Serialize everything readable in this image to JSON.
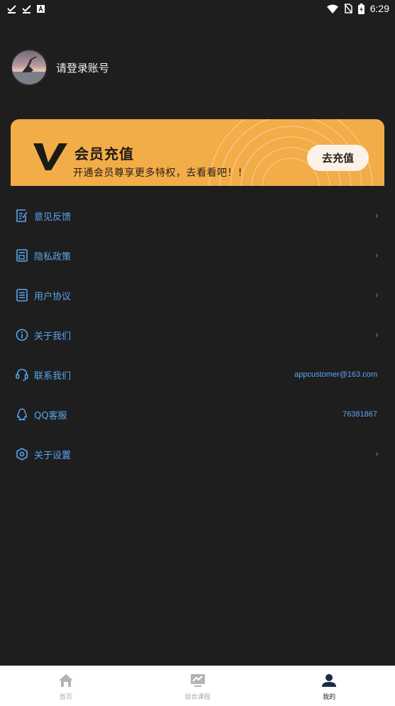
{
  "status_bar": {
    "time": "6:29",
    "left_icons": [
      "check-download-icon",
      "check-download-icon",
      "a-notification-icon"
    ],
    "right_icons": [
      "wifi-icon",
      "no-sim-icon",
      "battery-icon"
    ]
  },
  "profile": {
    "name": "请登录账号",
    "avatar_icon": "avatar-photo"
  },
  "vip": {
    "title": "会员充值",
    "subtitle": "开通会员尊享更多特权，去看看吧！！",
    "button_label": "去充值",
    "color": "#f2ac48"
  },
  "menu": {
    "items": [
      {
        "icon": "feedback-icon",
        "label": "意见反馈",
        "value": "",
        "chevron": "›"
      },
      {
        "icon": "privacy-icon",
        "label": "隐私政策",
        "value": "",
        "chevron": "›"
      },
      {
        "icon": "agreement-icon",
        "label": "用户协议",
        "value": "",
        "chevron": "›"
      },
      {
        "icon": "info-icon",
        "label": "关于我们",
        "value": "",
        "chevron": "›"
      },
      {
        "icon": "headset-icon",
        "label": "联系我们",
        "value": "appcustomer@163.com",
        "chevron": ""
      },
      {
        "icon": "qq-icon",
        "label": "QQ客服",
        "value": "76381867",
        "chevron": ""
      },
      {
        "icon": "settings-icon",
        "label": "关于设置",
        "value": "",
        "chevron": "›"
      }
    ],
    "accent": "#5aa6ef"
  },
  "bottom_nav": {
    "items": [
      {
        "icon": "home-icon",
        "label": "首页",
        "active": false
      },
      {
        "icon": "course-icon",
        "label": "综合课程",
        "active": false
      },
      {
        "icon": "profile-icon",
        "label": "我的",
        "active": true
      }
    ]
  }
}
